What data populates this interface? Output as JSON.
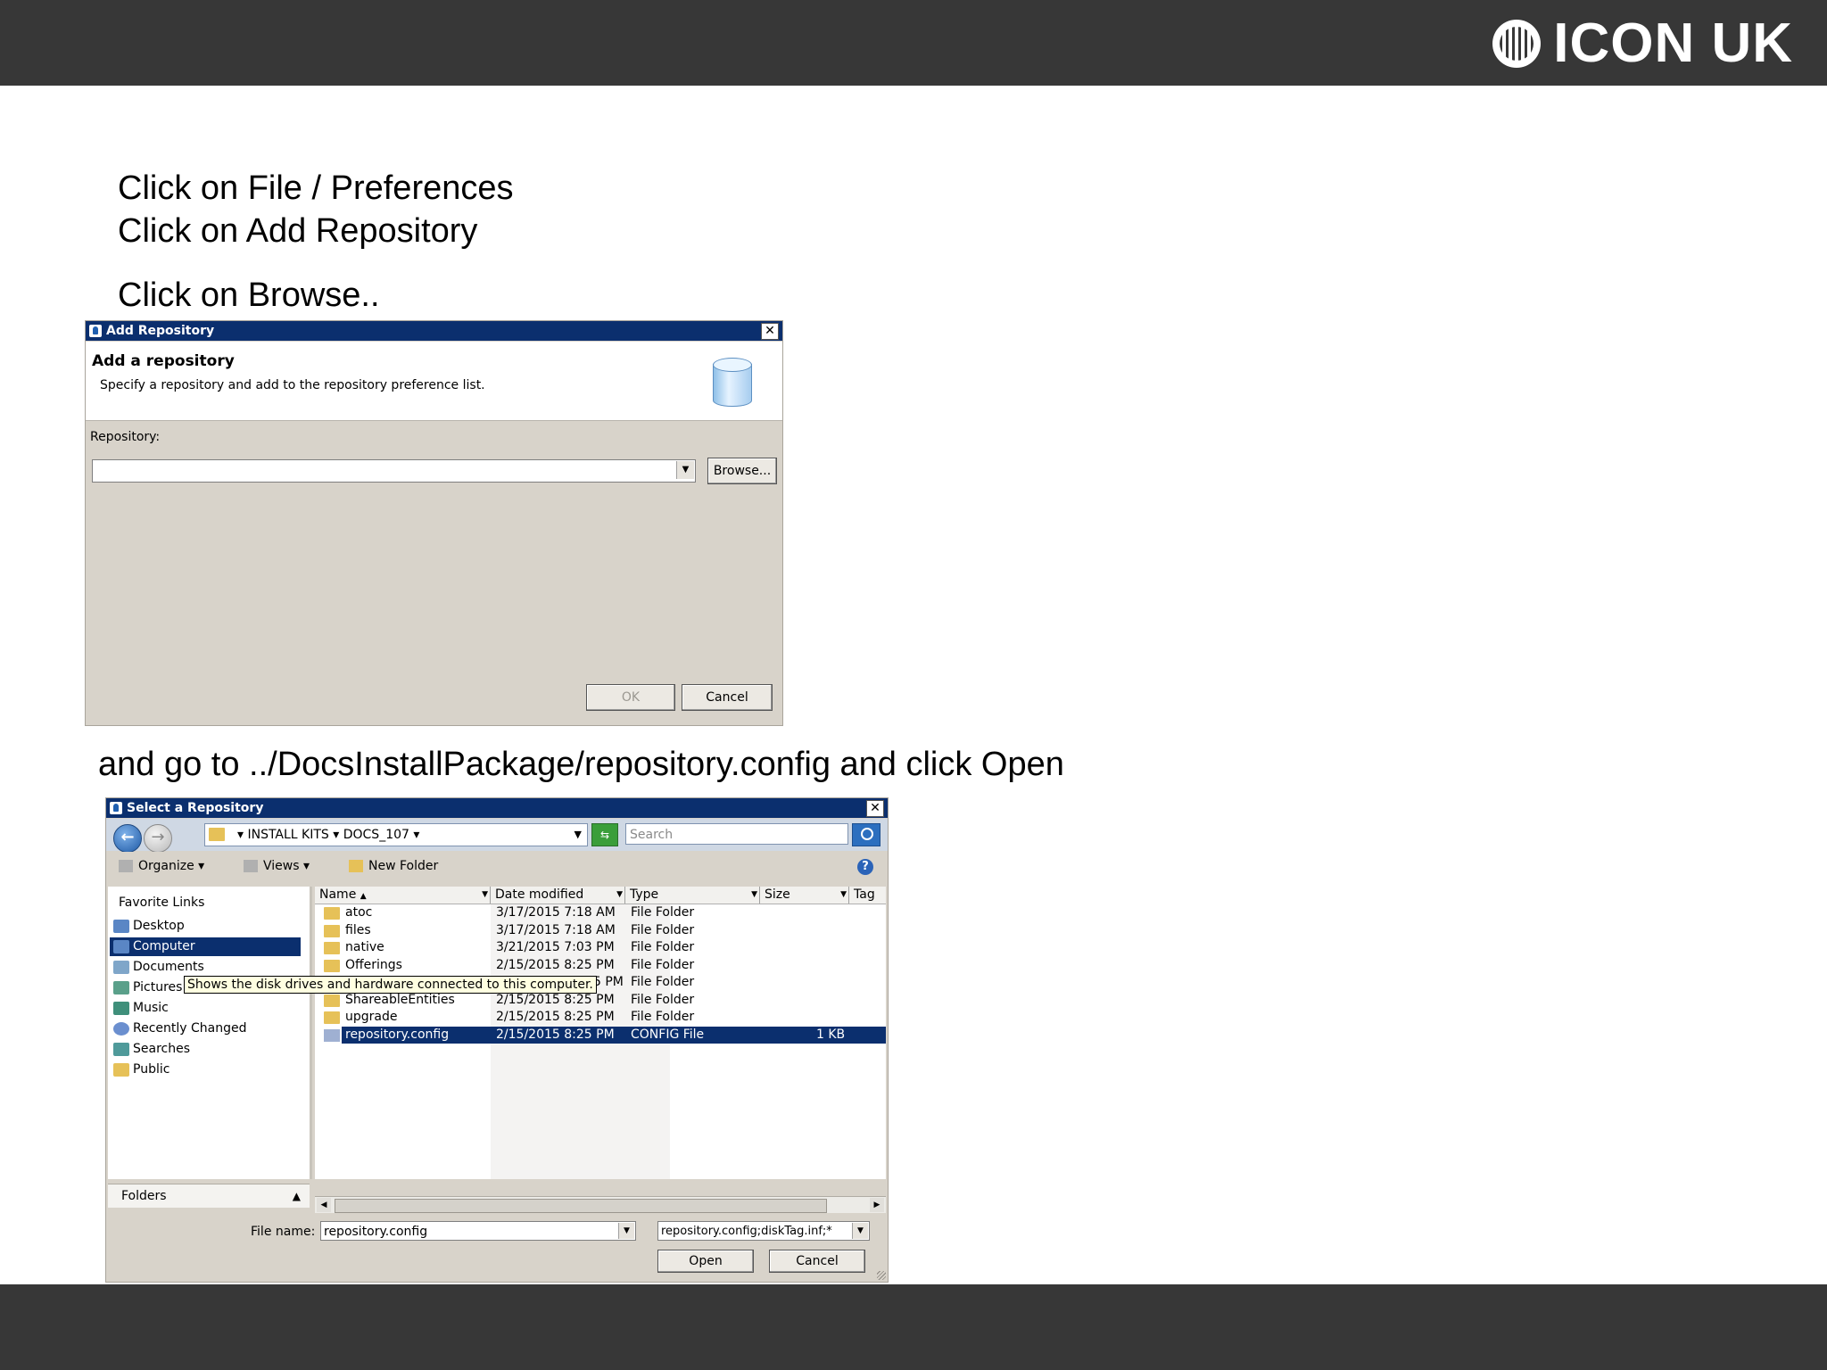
{
  "brand": {
    "logo_text": "ICON UK"
  },
  "instructions": {
    "line1": "Click on File / Preferences",
    "line2": "Click on Add Repository",
    "line3": "Click on Browse..",
    "line4": "and go to ../DocsInstallPackage/repository.config and click Open"
  },
  "add_dialog": {
    "title": "Add Repository",
    "heading": "Add a repository",
    "description": "Specify a repository and add to the repository preference list.",
    "repository_label": "Repository:",
    "repository_value": "",
    "browse_label": "Browse...",
    "ok_label": "OK",
    "cancel_label": "Cancel"
  },
  "select_dialog": {
    "title": "Select a Repository",
    "address": "▾ INSTALL KITS ▾ DOCS_107 ▾",
    "search_placeholder": "Search",
    "toolbar": {
      "organize": "Organize ▾",
      "views": "Views ▾",
      "new_folder": "New Folder"
    },
    "nav": {
      "favorites_label": "Favorite Links",
      "items": [
        "Desktop",
        "Computer",
        "Documents",
        "Pictures",
        "Music",
        "Recently Changed",
        "Searches",
        "Public"
      ],
      "selected": "Computer",
      "folders_label": "Folders"
    },
    "columns": [
      "Name",
      "Date modified",
      "Type",
      "Size",
      "Tag"
    ],
    "files": [
      {
        "name": "atoc",
        "date": "3/17/2015 7:18 AM",
        "type": "File Folder",
        "size": ""
      },
      {
        "name": "files",
        "date": "3/17/2015 7:18 AM",
        "type": "File Folder",
        "size": ""
      },
      {
        "name": "native",
        "date": "3/21/2015 7:03 PM",
        "type": "File Folder",
        "size": ""
      },
      {
        "name": "Offerings",
        "date": "2/15/2015 8:25 PM",
        "type": "File Folder",
        "size": ""
      },
      {
        "name": "",
        "date": "5 PM",
        "type": "File Folder",
        "size": ""
      },
      {
        "name": "ShareableEntities",
        "date": "2/15/2015 8:25 PM",
        "type": "File Folder",
        "size": ""
      },
      {
        "name": "upgrade",
        "date": "2/15/2015 8:25 PM",
        "type": "File Folder",
        "size": ""
      },
      {
        "name": "repository.config",
        "date": "2/15/2015 8:25 PM",
        "type": "CONFIG File",
        "size": "1 KB"
      }
    ],
    "selected_file": "repository.config",
    "tooltip": "Shows the disk drives and hardware connected to this computer.",
    "file_name_label": "File name:",
    "file_name_value": "repository.config",
    "filter_value": "repository.config;diskTag.inf;*",
    "open_label": "Open",
    "cancel_label": "Cancel"
  }
}
